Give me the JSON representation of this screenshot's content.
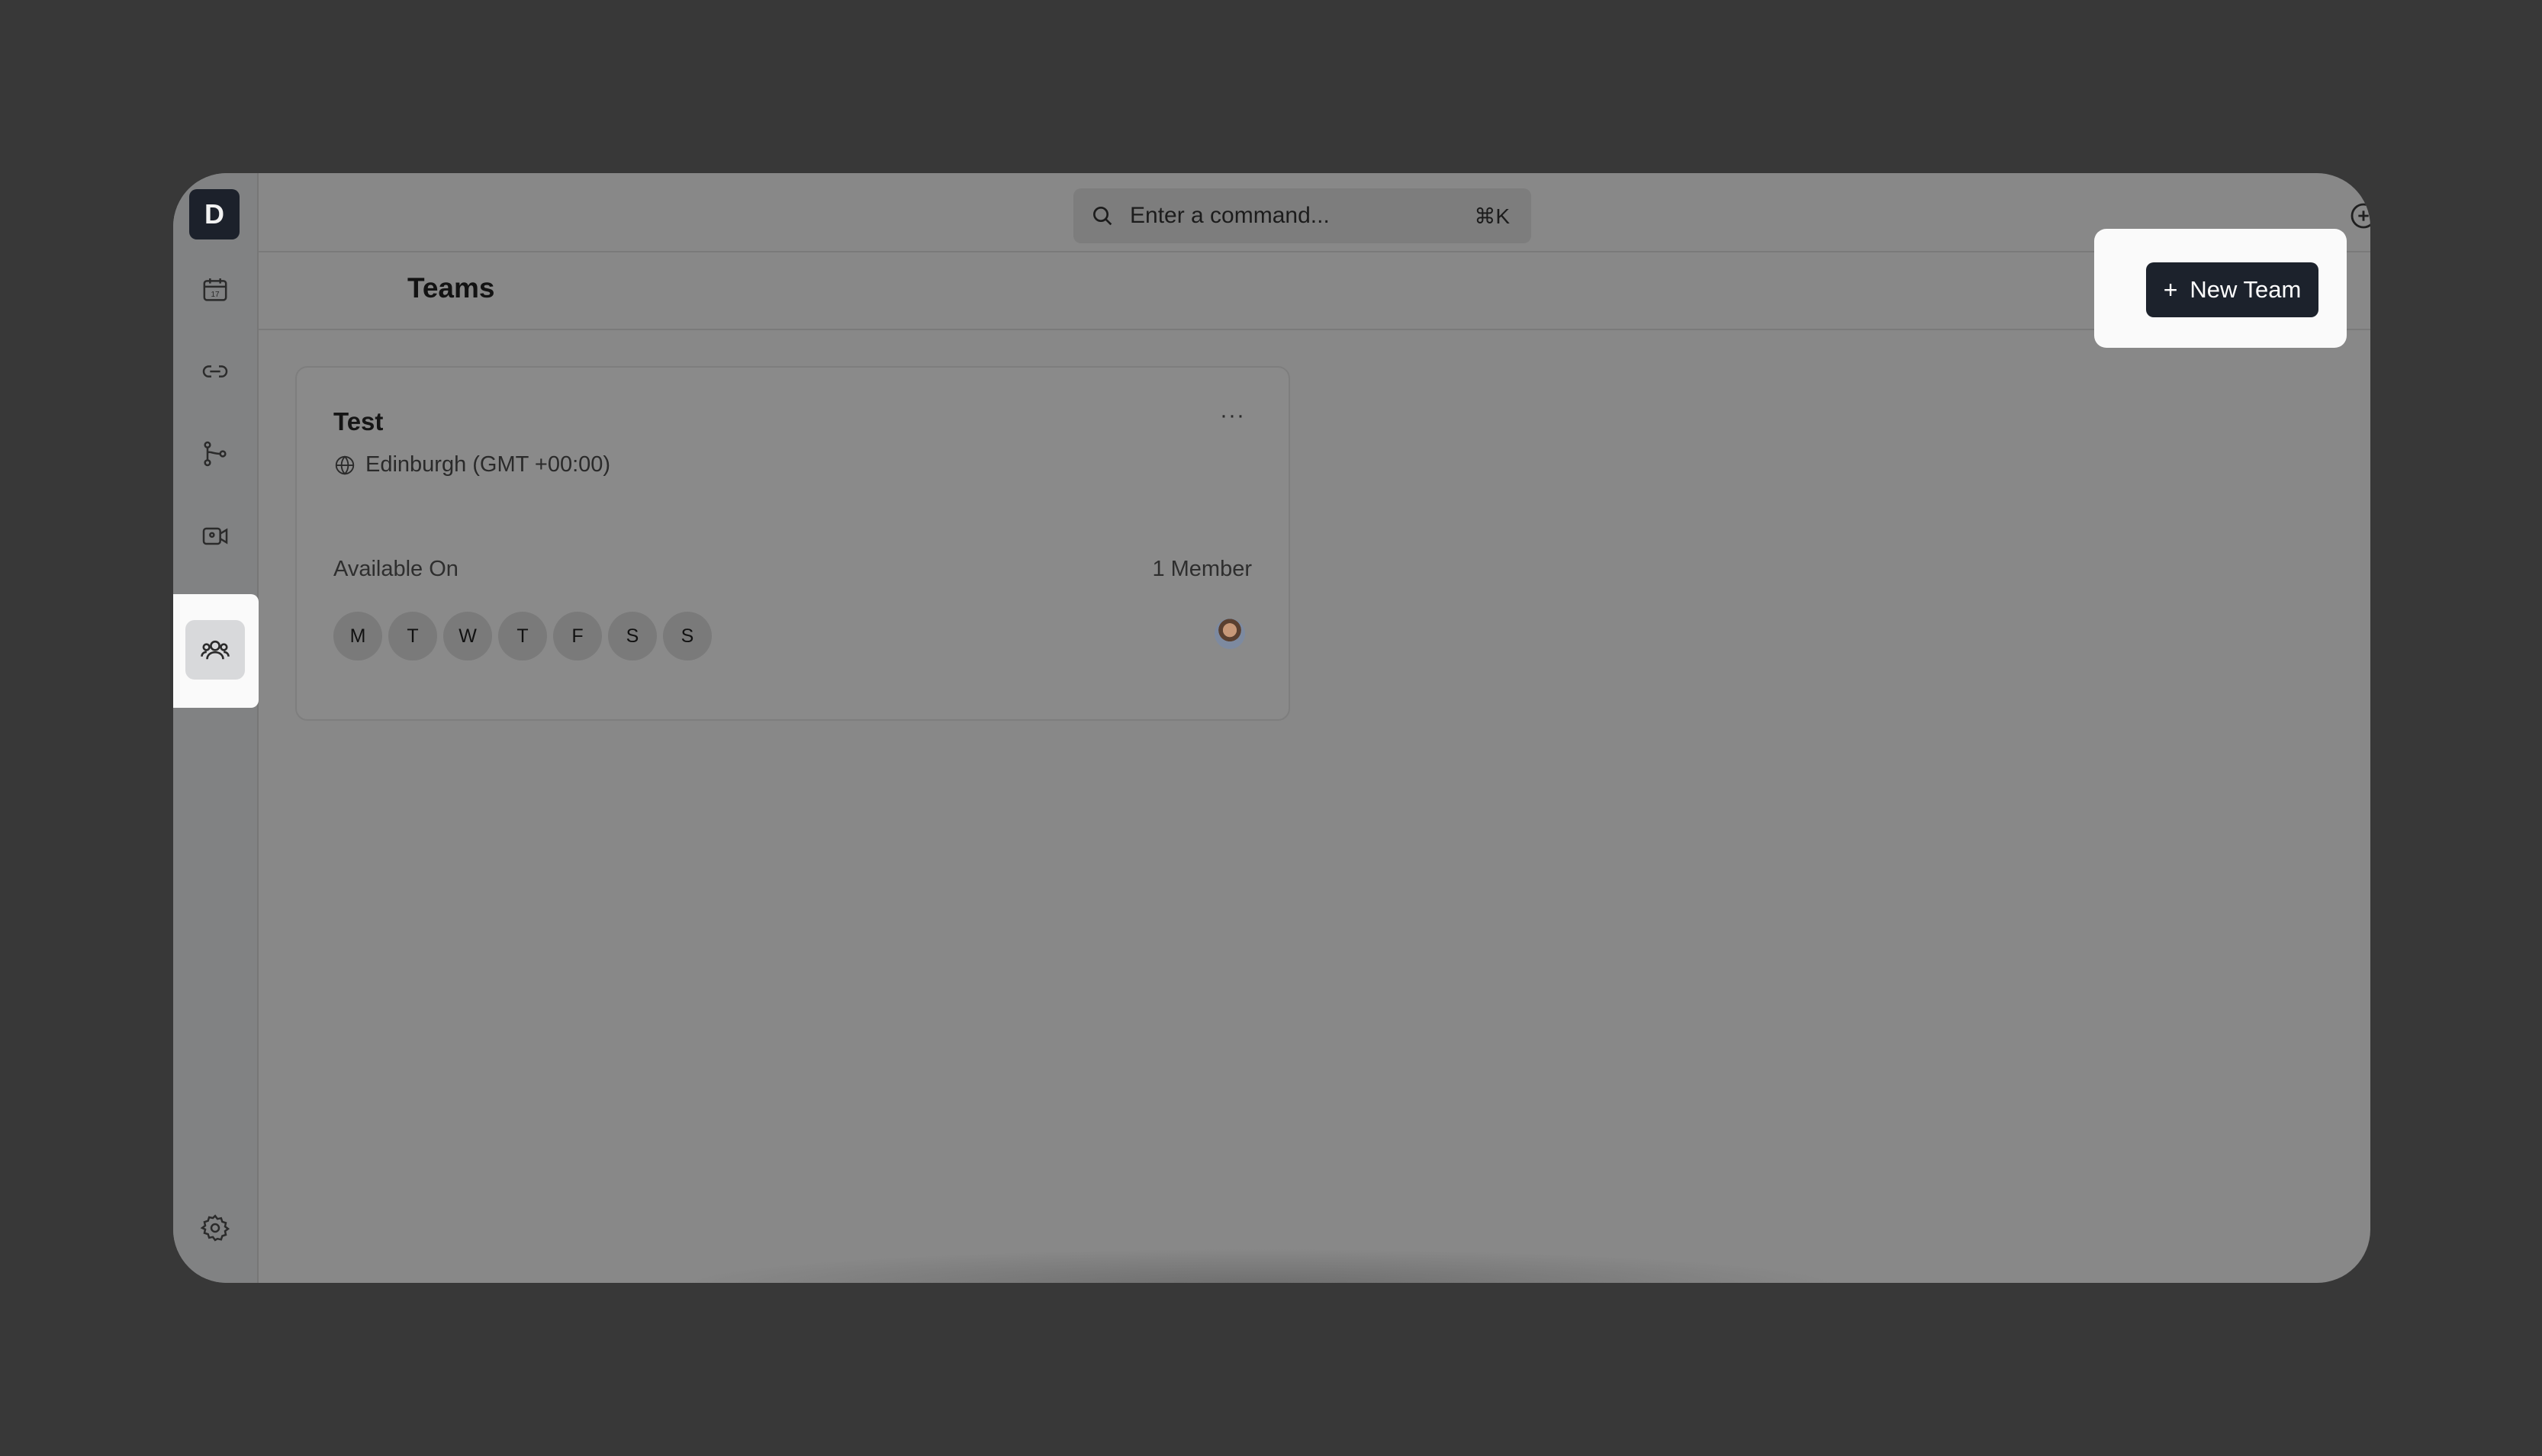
{
  "sidebar": {
    "logo_text": "D",
    "items": [
      {
        "name": "calendar-icon",
        "active": false
      },
      {
        "name": "link-icon",
        "active": false
      },
      {
        "name": "workflow-icon",
        "active": false
      },
      {
        "name": "video-icon",
        "active": false
      },
      {
        "name": "users-icon",
        "active": true
      },
      {
        "name": "gear-icon",
        "active": false
      }
    ]
  },
  "header": {
    "search": {
      "placeholder": "Enter a command...",
      "shortcut": "⌘K"
    },
    "icons": [
      "add-circle-icon",
      "help-icon",
      "user-avatar"
    ]
  },
  "page": {
    "title": "Teams"
  },
  "actions": {
    "new_team_icon": "+",
    "new_team_label": "New Team"
  },
  "teams": [
    {
      "name": "Test",
      "menu": "···",
      "timezone": "Edinburgh (GMT +00:00)",
      "available_label": "Available On",
      "member_count": "1 Member",
      "days": [
        "M",
        "T",
        "W",
        "T",
        "F",
        "S",
        "S"
      ]
    }
  ],
  "colors": {
    "overlay": "#888888",
    "primary_button": "#1c222c",
    "spotlight": "#fafafa"
  }
}
